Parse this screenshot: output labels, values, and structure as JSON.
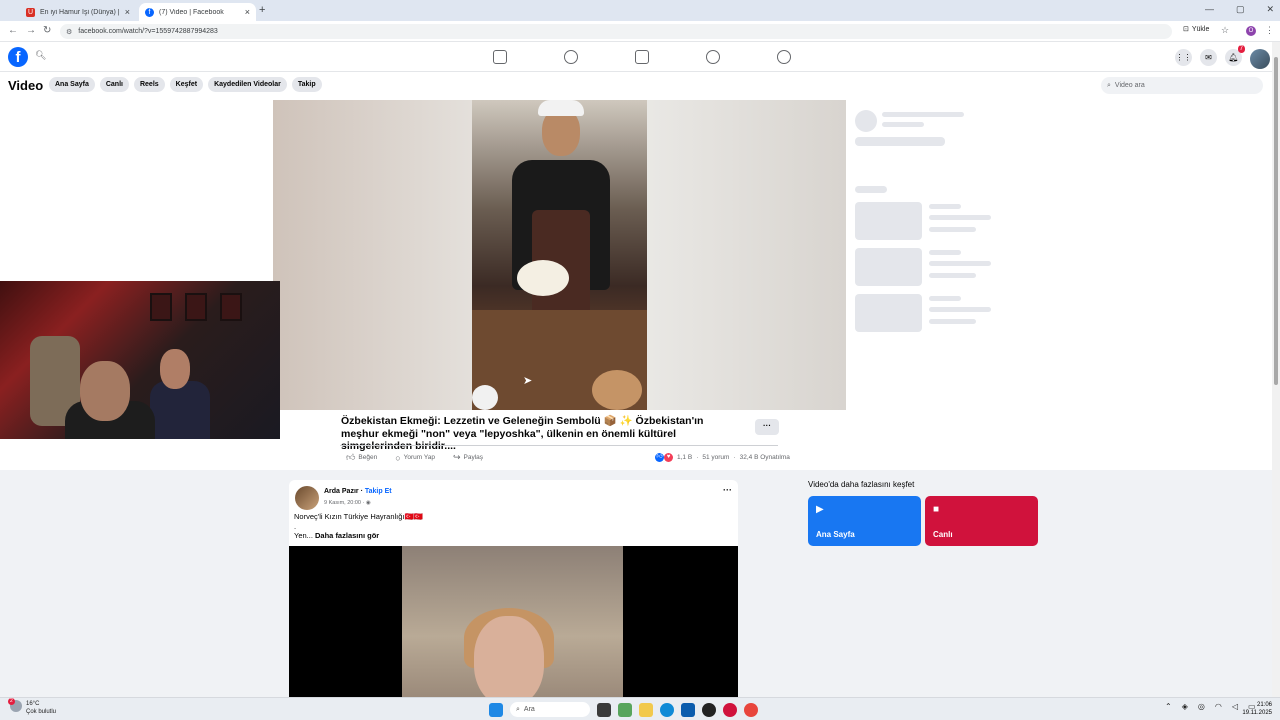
{
  "browser": {
    "tabs": [
      {
        "label": "En iyi Hamur İşi (Dünya) | UwU",
        "close": "×",
        "favicon_color": "#d93025",
        "favicon_text": "U"
      },
      {
        "label": "(7) Video | Facebook",
        "close": "×",
        "favicon_color": "#0866ff",
        "favicon_text": "f"
      }
    ],
    "new_tab": "+",
    "window_controls": [
      "—",
      "▢",
      "✕"
    ],
    "url": "facebook.com/watch/?v=1559742887994283",
    "install_label": "Yükle",
    "profile_initial": "O"
  },
  "fb_header": {
    "logo": "f",
    "notification_count": "7"
  },
  "video_nav": {
    "title": "Video",
    "pills": [
      "Ana Sayfa",
      "Canlı",
      "Reels",
      "Keşfet",
      "Kaydedilen Videolar",
      "Takip"
    ],
    "search_placeholder": "Video ara"
  },
  "video": {
    "title": "Özbekistan Ekmeği: Lezzetin ve Geleneğin Sembolü 📦 ✨ Özbekistan'ın meşhur ekmeği \"non\" veya \"lepyoshka\", ülkenin en önemli kültürel simgelerinden biridir....",
    "more": "···",
    "actions": {
      "like": "Beğen",
      "comment": "Yorum Yap",
      "share": "Paylaş"
    },
    "stats": {
      "reactions": "1,1 B",
      "comments": "51 yorum",
      "views": "32,4 B Oynatılma"
    }
  },
  "post": {
    "author": "Arda Pazır",
    "follow": "Takip Et",
    "date": "9 Kasım, 20:00",
    "text": "Norveç'li Kızın Türkiye Hayranlığı🇹🇷🇹🇷",
    "dot": ".",
    "truncated": "Yen...",
    "see_more": "Daha fazlasını gör",
    "menu": "···"
  },
  "explore": {
    "title": "Video'da daha fazlasını keşfet",
    "cards": [
      {
        "label": "Ana Sayfa",
        "color": "#1877f2"
      },
      {
        "label": "Canlı",
        "color": "#d0123c"
      }
    ]
  },
  "taskbar": {
    "weather_temp": "16°C",
    "weather_desc": "Çok bulutlu",
    "weather_badge": "2",
    "search_placeholder": "Ara",
    "time": "21:06",
    "date": "19.11.2025"
  }
}
